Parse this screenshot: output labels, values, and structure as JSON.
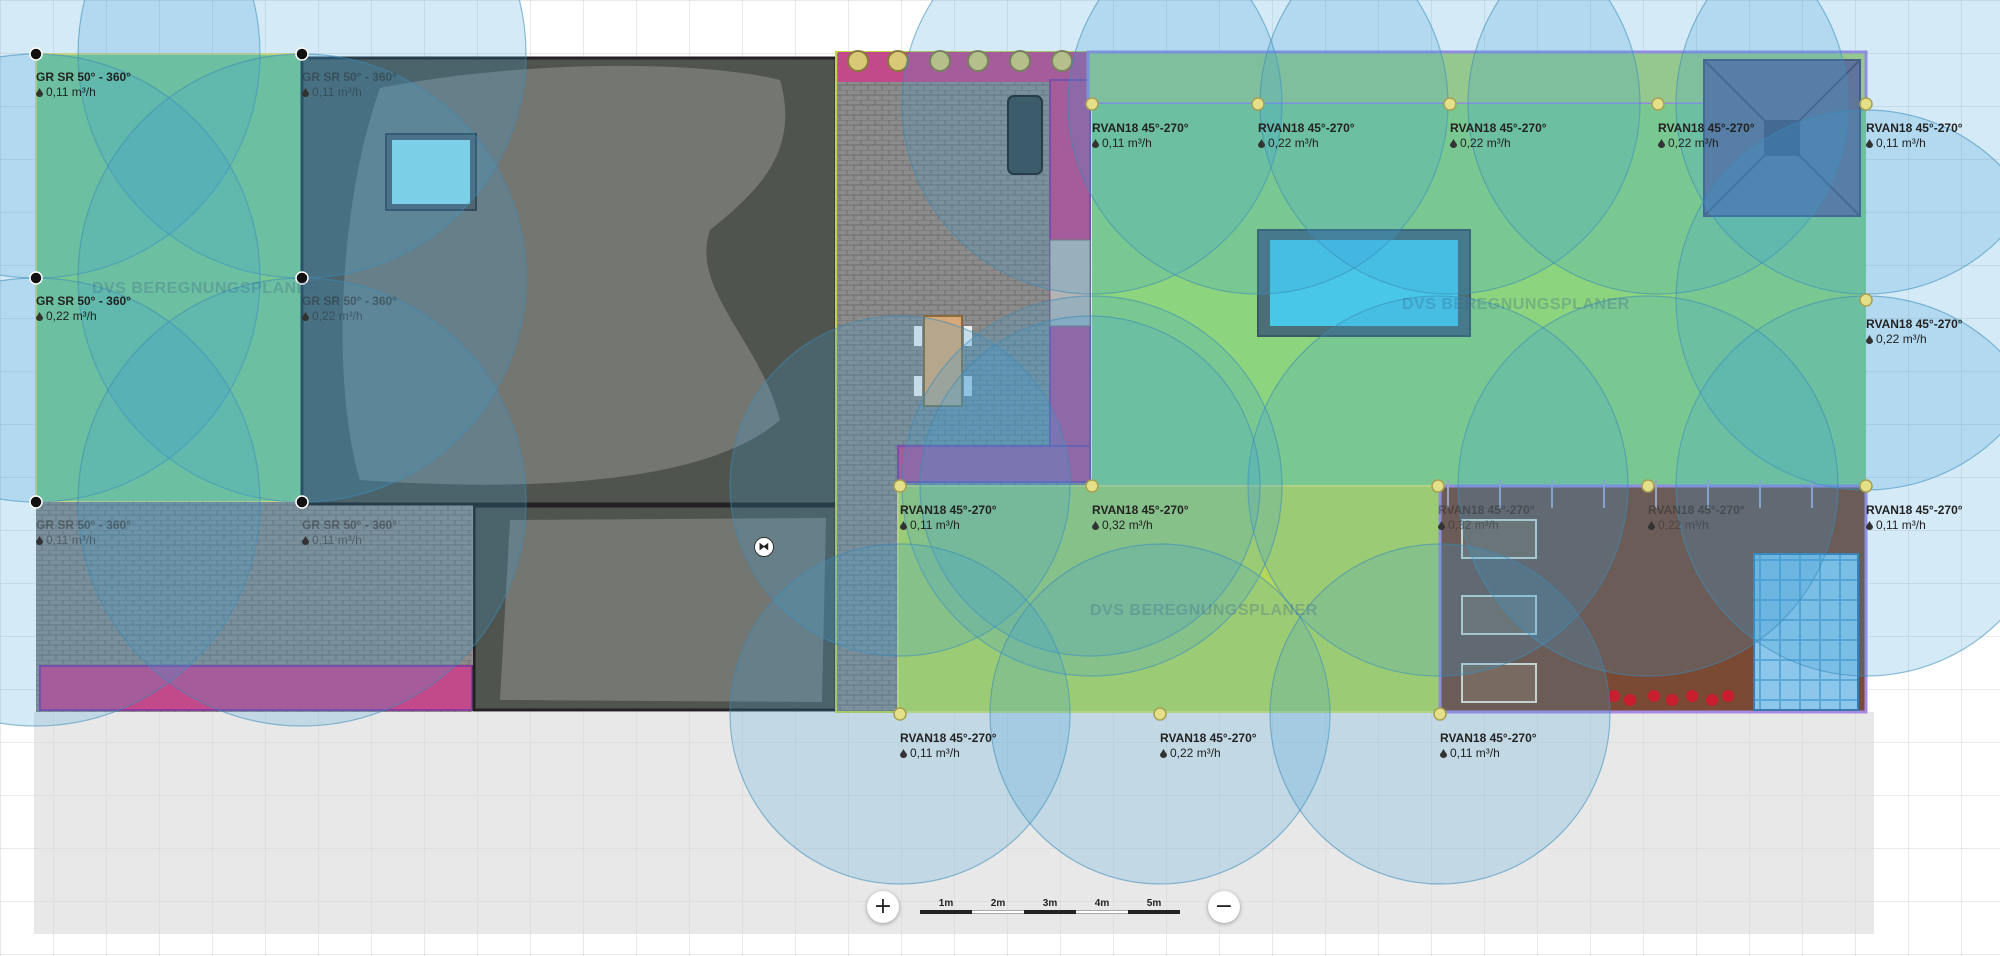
{
  "watermark": "DVS BEREGNUNGSPLANER",
  "sprinklers": [
    {
      "id": "s1",
      "model": "GR SR 50° - 360°",
      "flow": "0,11 m³/h",
      "faded": false
    },
    {
      "id": "s2",
      "model": "GR SR 50° - 360°",
      "flow": "0,11 m³/h",
      "faded": true
    },
    {
      "id": "s3",
      "model": "GR SR 50° - 360°",
      "flow": "0,22 m³/h",
      "faded": false
    },
    {
      "id": "s4",
      "model": "GR SR 50° - 360°",
      "flow": "0,22 m³/h",
      "faded": true
    },
    {
      "id": "s5",
      "model": "GR SR 50° - 360°",
      "flow": "0,11 m³/h",
      "faded": true
    },
    {
      "id": "s6",
      "model": "GR SR 50° - 360°",
      "flow": "0,11 m³/h",
      "faded": true
    },
    {
      "id": "r1",
      "model": "RVAN18 45°-270°",
      "flow": "0,11 m³/h",
      "faded": false
    },
    {
      "id": "r2",
      "model": "RVAN18 45°-270°",
      "flow": "0,22 m³/h",
      "faded": false
    },
    {
      "id": "r3",
      "model": "RVAN18 45°-270°",
      "flow": "0,22 m³/h",
      "faded": false
    },
    {
      "id": "r4",
      "model": "RVAN18 45°-270°",
      "flow": "0,22 m³/h",
      "faded": false
    },
    {
      "id": "r5",
      "model": "RVAN18 45°-270°",
      "flow": "0,11 m³/h",
      "faded": false
    },
    {
      "id": "r6",
      "model": "RVAN18 45°-270°",
      "flow": "0,22 m³/h",
      "faded": false
    },
    {
      "id": "r7",
      "model": "RVAN18 45°-270°",
      "flow": "0,11 m³/h",
      "faded": false
    },
    {
      "id": "r8",
      "model": "RVAN18 45°-270°",
      "flow": "0,32 m³/h",
      "faded": false
    },
    {
      "id": "r9",
      "model": "RVAN18 45°-270°",
      "flow": "0,32 m³/h",
      "faded": true
    },
    {
      "id": "r10",
      "model": "RVAN18 45°-270°",
      "flow": "0,22 m³/h",
      "faded": true
    },
    {
      "id": "r11",
      "model": "RVAN18 45°-270°",
      "flow": "0,11 m³/h",
      "faded": false
    },
    {
      "id": "r12",
      "model": "RVAN18 45°-270°",
      "flow": "0,11 m³/h",
      "faded": false
    },
    {
      "id": "r13",
      "model": "RVAN18 45°-270°",
      "flow": "0,22 m³/h",
      "faded": false
    },
    {
      "id": "r14",
      "model": "RVAN18 45°-270°",
      "flow": "0,11 m³/h",
      "faded": false
    }
  ],
  "zoom": {
    "in_label": "+",
    "out_label": "−"
  },
  "scale_bar": {
    "ticks": [
      "1m",
      "2m",
      "3m",
      "4m",
      "5m"
    ]
  },
  "icons": {
    "drop": "water-drop-icon",
    "move": "move-handle-icon"
  },
  "colors": {
    "lawn": "#8cd47e",
    "coverage": "#3aa0d8",
    "paving": "#8a8a8a",
    "roof": "#555a55",
    "bed": "#c24a8a",
    "soil": "#7a4a35",
    "pool": "#49c7e8"
  }
}
